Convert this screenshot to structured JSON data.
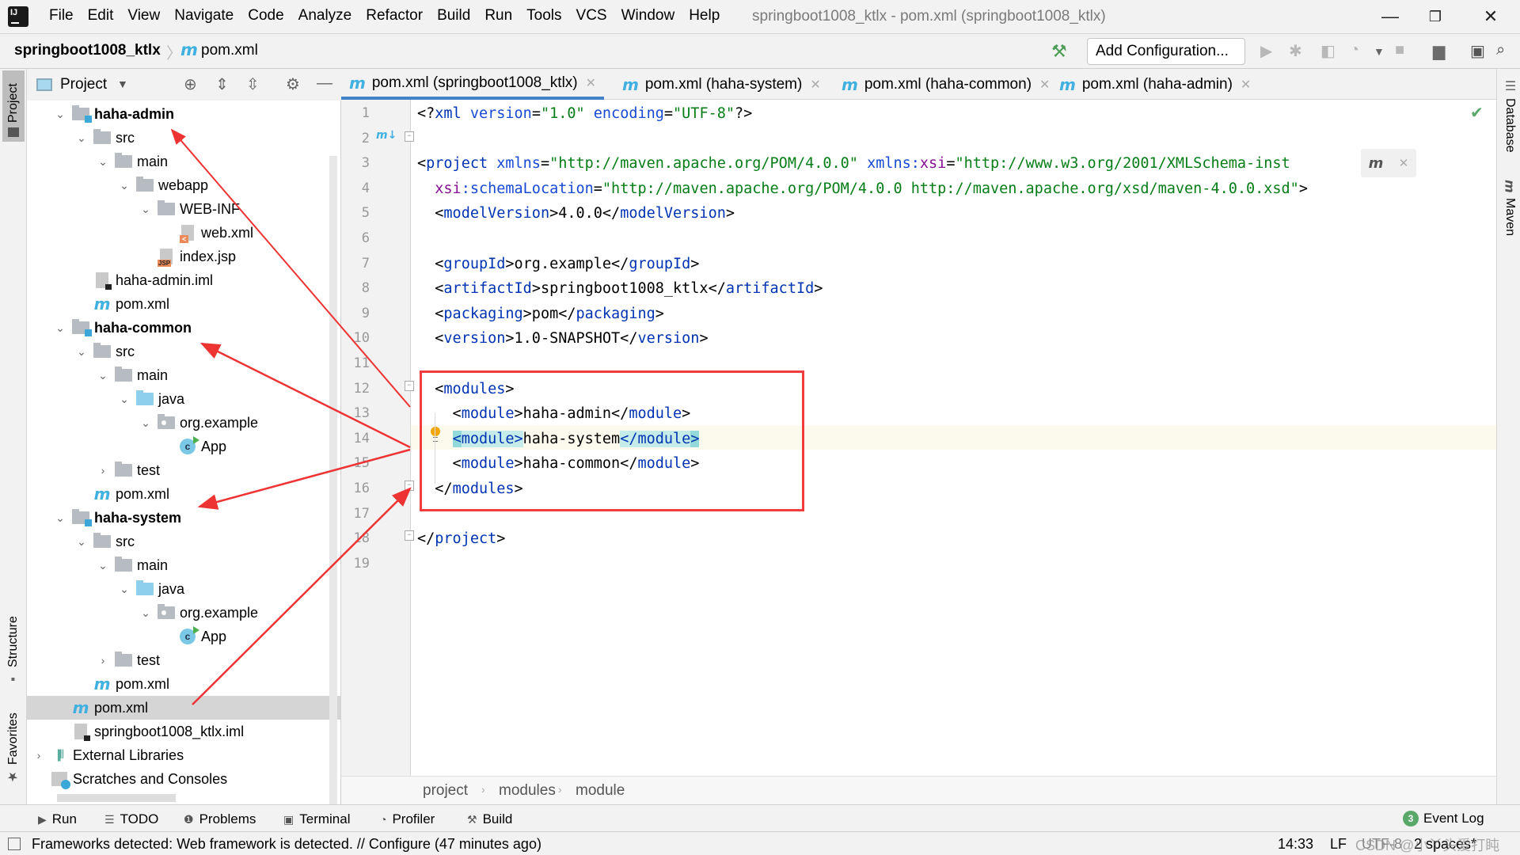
{
  "menubar": {
    "items": [
      "File",
      "Edit",
      "View",
      "Navigate",
      "Code",
      "Analyze",
      "Refactor",
      "Build",
      "Run",
      "Tools",
      "VCS",
      "Window",
      "Help"
    ],
    "window_title": "springboot1008_ktlx - pom.xml (springboot1008_ktlx)"
  },
  "navbar": {
    "project": "springboot1008_ktlx",
    "file": "pom.xml",
    "add_configuration": "Add Configuration..."
  },
  "left_stripe": {
    "project": "Project",
    "structure": "Structure",
    "favorites": "Favorites"
  },
  "right_stripe": {
    "database": "Database",
    "maven": "Maven"
  },
  "project_panel": {
    "title": "Project",
    "tree": [
      {
        "label": "haha-admin",
        "depth": 1,
        "type": "module",
        "expanded": true,
        "bold": true
      },
      {
        "label": "src",
        "depth": 2,
        "type": "folder",
        "expanded": true
      },
      {
        "label": "main",
        "depth": 3,
        "type": "folder",
        "expanded": true
      },
      {
        "label": "webapp",
        "depth": 4,
        "type": "folder",
        "expanded": true
      },
      {
        "label": "WEB-INF",
        "depth": 5,
        "type": "folder",
        "expanded": true
      },
      {
        "label": "web.xml",
        "depth": 6,
        "type": "xml"
      },
      {
        "label": "index.jsp",
        "depth": 5,
        "type": "jsp"
      },
      {
        "label": "haha-admin.iml",
        "depth": 2,
        "type": "iml"
      },
      {
        "label": "pom.xml",
        "depth": 2,
        "type": "pom"
      },
      {
        "label": "haha-common",
        "depth": 1,
        "type": "module",
        "expanded": true,
        "bold": true
      },
      {
        "label": "src",
        "depth": 2,
        "type": "folder",
        "expanded": true
      },
      {
        "label": "main",
        "depth": 3,
        "type": "folder",
        "expanded": true
      },
      {
        "label": "java",
        "depth": 4,
        "type": "source",
        "expanded": true
      },
      {
        "label": "org.example",
        "depth": 5,
        "type": "package",
        "expanded": true
      },
      {
        "label": "App",
        "depth": 6,
        "type": "class"
      },
      {
        "label": "test",
        "depth": 3,
        "type": "folder",
        "expanded": false
      },
      {
        "label": "pom.xml",
        "depth": 2,
        "type": "pom"
      },
      {
        "label": "haha-system",
        "depth": 1,
        "type": "module",
        "expanded": true,
        "bold": true
      },
      {
        "label": "src",
        "depth": 2,
        "type": "folder",
        "expanded": true
      },
      {
        "label": "main",
        "depth": 3,
        "type": "folder",
        "expanded": true
      },
      {
        "label": "java",
        "depth": 4,
        "type": "source",
        "expanded": true
      },
      {
        "label": "org.example",
        "depth": 5,
        "type": "package",
        "expanded": true
      },
      {
        "label": "App",
        "depth": 6,
        "type": "class"
      },
      {
        "label": "test",
        "depth": 3,
        "type": "folder",
        "expanded": false
      },
      {
        "label": "pom.xml",
        "depth": 2,
        "type": "pom"
      },
      {
        "label": "pom.xml",
        "depth": 1,
        "type": "pom",
        "selected": true
      },
      {
        "label": "springboot1008_ktlx.iml",
        "depth": 1,
        "type": "iml"
      },
      {
        "label": "External Libraries",
        "depth": 0,
        "type": "libs",
        "expanded": false
      },
      {
        "label": "Scratches and Consoles",
        "depth": 0,
        "type": "scratch"
      }
    ]
  },
  "tabs": [
    {
      "label": "pom.xml (springboot1008_ktlx)",
      "active": true
    },
    {
      "label": "pom.xml (haha-system)"
    },
    {
      "label": "pom.xml (haha-common)"
    },
    {
      "label": "pom.xml (haha-admin)"
    }
  ],
  "editor": {
    "current_line": 14,
    "lines": [
      [
        [
          "p",
          "<?"
        ],
        [
          "t",
          "xml "
        ],
        [
          "a",
          "version"
        ],
        [
          "p",
          "="
        ],
        [
          "s",
          "\"1.0\" "
        ],
        [
          "a",
          "encoding"
        ],
        [
          "p",
          "="
        ],
        [
          "s",
          "\"UTF-8\""
        ],
        [
          "p",
          "?>"
        ]
      ],
      [],
      [
        [
          "p",
          "<"
        ],
        [
          "t",
          "project "
        ],
        [
          "a",
          "xmlns"
        ],
        [
          "p",
          "="
        ],
        [
          "s",
          "\"http://maven.apache.org/POM/4.0.0\" "
        ],
        [
          "a",
          "xmlns:"
        ],
        [
          "ns",
          "xsi"
        ],
        [
          "p",
          "="
        ],
        [
          "s",
          "\"http://www.w3.org/2001/XMLSchema-inst"
        ]
      ],
      [
        [
          "p",
          "  "
        ],
        [
          "ns",
          "xsi"
        ],
        [
          "a",
          ":schemaLocation"
        ],
        [
          "p",
          "="
        ],
        [
          "s",
          "\"http://maven.apache.org/POM/4.0.0 http://maven.apache.org/xsd/maven-4.0.0.xsd\""
        ],
        [
          "p",
          ">"
        ]
      ],
      [
        [
          "p",
          "  <"
        ],
        [
          "t",
          "modelVersion"
        ],
        [
          "p",
          ">4.0.0</"
        ],
        [
          "t",
          "modelVersion"
        ],
        [
          "p",
          ">"
        ]
      ],
      [],
      [
        [
          "p",
          "  <"
        ],
        [
          "t",
          "groupId"
        ],
        [
          "p",
          ">org.example</"
        ],
        [
          "t",
          "groupId"
        ],
        [
          "p",
          ">"
        ]
      ],
      [
        [
          "p",
          "  <"
        ],
        [
          "t",
          "artifactId"
        ],
        [
          "p",
          ">springboot1008_ktlx</"
        ],
        [
          "t",
          "artifactId"
        ],
        [
          "p",
          ">"
        ]
      ],
      [
        [
          "p",
          "  <"
        ],
        [
          "t",
          "packaging"
        ],
        [
          "p",
          ">pom</"
        ],
        [
          "t",
          "packaging"
        ],
        [
          "p",
          ">"
        ]
      ],
      [
        [
          "p",
          "  <"
        ],
        [
          "t",
          "version"
        ],
        [
          "p",
          ">1.0-SNAPSHOT</"
        ],
        [
          "t",
          "version"
        ],
        [
          "p",
          ">"
        ]
      ],
      [],
      [
        [
          "p",
          "  <"
        ],
        [
          "t",
          "modules"
        ],
        [
          "p",
          ">"
        ]
      ],
      [
        [
          "p",
          "    <"
        ],
        [
          "t",
          "module"
        ],
        [
          "p",
          ">haha-admin</"
        ],
        [
          "t",
          "module"
        ],
        [
          "p",
          ">"
        ]
      ],
      [
        [
          "p",
          "    "
        ],
        [
          "hl2",
          "<"
        ],
        [
          "hl",
          "module>"
        ],
        [
          "p",
          "haha-system"
        ],
        [
          "hl",
          "</module"
        ],
        [
          "hl2",
          ">"
        ]
      ],
      [
        [
          "p",
          "    <"
        ],
        [
          "t",
          "module"
        ],
        [
          "p",
          ">haha-common</"
        ],
        [
          "t",
          "module"
        ],
        [
          "p",
          ">"
        ]
      ],
      [
        [
          "p",
          "  </"
        ],
        [
          "t",
          "modules"
        ],
        [
          "p",
          ">"
        ]
      ],
      [],
      [
        [
          "p",
          "</"
        ],
        [
          "t",
          "project"
        ],
        [
          "p",
          ">"
        ]
      ],
      []
    ]
  },
  "breadcrumbs": [
    "project",
    "modules",
    "module"
  ],
  "bottom_toolbar": {
    "run": "Run",
    "todo": "TODO",
    "problems": "Problems",
    "terminal": "Terminal",
    "profiler": "Profiler",
    "build": "Build",
    "event_log": "Event Log",
    "event_count": "3"
  },
  "statusbar": {
    "message": "Frameworks detected: Web framework is detected. // Configure (47 minutes ago)",
    "position": "14:33",
    "line_sep": "LF",
    "encoding": "UTF-8",
    "indent": "2 spaces*",
    "watermark": "CSDN @小丫头爱打盹"
  },
  "colors": {
    "annotation": "#f03c3c",
    "accent": "#4083c9",
    "maven": "#3fb0e0"
  }
}
